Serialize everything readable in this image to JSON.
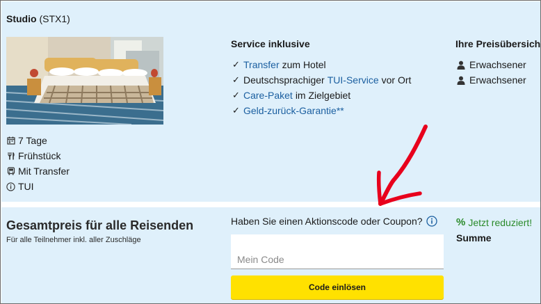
{
  "room": {
    "name": "Studio",
    "code": "(STX1)"
  },
  "features": [
    {
      "icon": "calendar-icon",
      "label": "7 Tage"
    },
    {
      "icon": "cutlery-icon",
      "label": "Frühstück"
    },
    {
      "icon": "bus-icon",
      "label": "Mit Transfer"
    },
    {
      "icon": "info-icon",
      "label": "TUI"
    }
  ],
  "service": {
    "title": "Service inklusive",
    "items": [
      {
        "before": "",
        "link": "Transfer",
        "after": "zum Hotel"
      },
      {
        "before": "Deutschsprachiger",
        "link": "TUI-Service",
        "after": "vor Ort"
      },
      {
        "before": "",
        "link": "Care-Paket",
        "after": "im Zielgebiet"
      },
      {
        "before": "",
        "link": "Geld-zurück-Garantie**",
        "after": ""
      }
    ]
  },
  "price_overview": {
    "title": "Ihre Preisübersicht",
    "persons": [
      "Erwachsener",
      "Erwachsener"
    ]
  },
  "total": {
    "title": "Gesamtpreis für alle Reisenden",
    "subtitle": "Für alle Teilnehmer inkl. aller Zuschläge",
    "reduced_symbol": "%",
    "reduced_label": "Jetzt reduziert!",
    "sum_label": "Summe"
  },
  "coupon": {
    "question": "Haben Sie einen Aktionscode oder Coupon?",
    "placeholder": "Mein Code",
    "value": "",
    "button_label": "Code einlösen"
  },
  "colors": {
    "panel_bg": "#dff0fb",
    "link": "#1b5fa0",
    "button_yellow": "#ffe100",
    "reduced_green": "#2a8a2a",
    "annotation_red": "#e8001c"
  }
}
